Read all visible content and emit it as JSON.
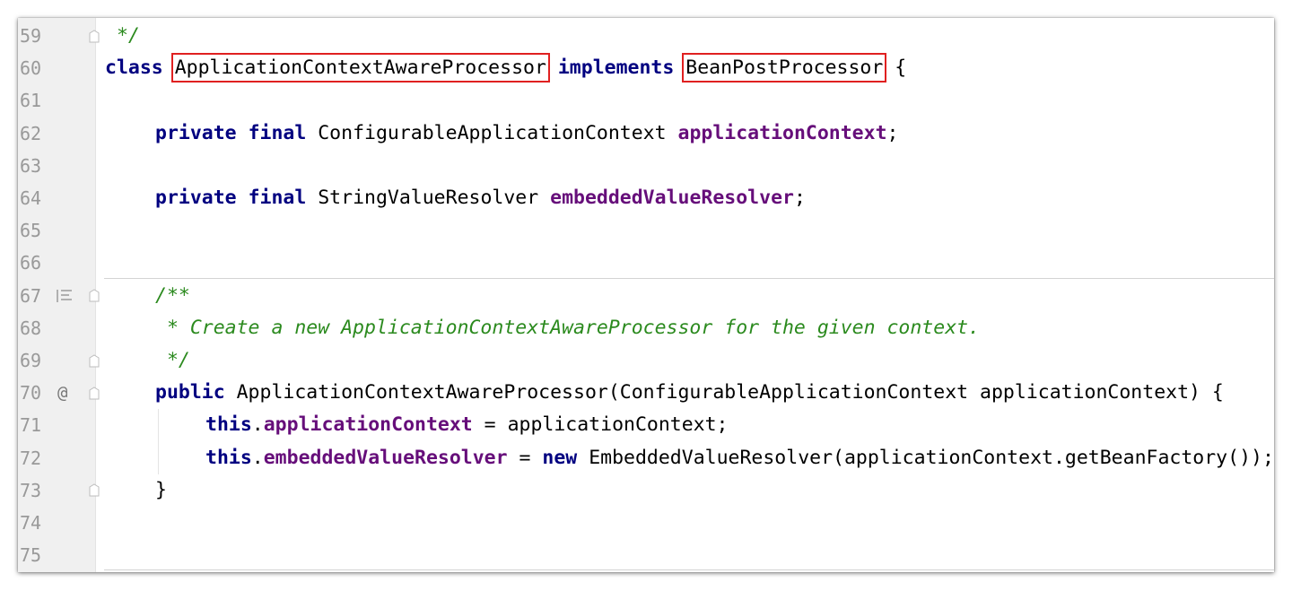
{
  "editor": {
    "lines": [
      {
        "num": "59",
        "tokens": [
          {
            "t": " */",
            "c": "cmt"
          }
        ],
        "indent": 0,
        "fold": true
      },
      {
        "num": "60",
        "tokens": [
          {
            "t": "class",
            "c": "kw"
          },
          {
            "t": " "
          },
          {
            "t": "ApplicationContextAwareProcessor",
            "hl": true
          },
          {
            "t": " "
          },
          {
            "t": "implements",
            "c": "kw"
          },
          {
            "t": " "
          },
          {
            "t": "BeanPostProcessor",
            "hl": true
          },
          {
            "t": " {"
          }
        ],
        "indent": 0
      },
      {
        "num": "61",
        "tokens": [],
        "indent": 0
      },
      {
        "num": "62",
        "tokens": [
          {
            "t": "private",
            "c": "kw"
          },
          {
            "t": " "
          },
          {
            "t": "final",
            "c": "kw"
          },
          {
            "t": " ConfigurableApplicationContext "
          },
          {
            "t": "applicationContext",
            "c": "fld"
          },
          {
            "t": ";"
          }
        ],
        "indent": 1
      },
      {
        "num": "63",
        "tokens": [],
        "indent": 0
      },
      {
        "num": "64",
        "tokens": [
          {
            "t": "private",
            "c": "kw"
          },
          {
            "t": " "
          },
          {
            "t": "final",
            "c": "kw"
          },
          {
            "t": " StringValueResolver "
          },
          {
            "t": "embeddedValueResolver",
            "c": "fld"
          },
          {
            "t": ";"
          }
        ],
        "indent": 1
      },
      {
        "num": "65",
        "tokens": [],
        "indent": 0
      },
      {
        "num": "66",
        "tokens": [],
        "indent": 0,
        "separator_after": true
      },
      {
        "num": "67",
        "tokens": [
          {
            "t": "/**",
            "c": "cmt"
          }
        ],
        "indent": 1,
        "doc_icon": true,
        "fold": true
      },
      {
        "num": "68",
        "tokens": [
          {
            "t": " * Create a new ApplicationContextAwareProcessor for the given context.",
            "c": "cmt"
          }
        ],
        "indent": 1
      },
      {
        "num": "69",
        "tokens": [
          {
            "t": " */",
            "c": "cmt"
          }
        ],
        "indent": 1,
        "fold": true
      },
      {
        "num": "70",
        "tokens": [
          {
            "t": "public",
            "c": "kw"
          },
          {
            "t": " ApplicationContextAwareProcessor(ConfigurableApplicationContext applicationContext) {"
          }
        ],
        "indent": 1,
        "annotation": "@",
        "fold": true
      },
      {
        "num": "71",
        "tokens": [
          {
            "t": "this",
            "c": "kw"
          },
          {
            "t": "."
          },
          {
            "t": "applicationContext",
            "c": "fld"
          },
          {
            "t": " = applicationContext;"
          }
        ],
        "indent": 2
      },
      {
        "num": "72",
        "tokens": [
          {
            "t": "this",
            "c": "kw"
          },
          {
            "t": "."
          },
          {
            "t": "embeddedValueResolver",
            "c": "fld"
          },
          {
            "t": " = "
          },
          {
            "t": "new",
            "c": "kw"
          },
          {
            "t": " EmbeddedValueResolver(applicationContext.getBeanFactory());"
          }
        ],
        "indent": 2
      },
      {
        "num": "73",
        "tokens": [
          {
            "t": "}"
          }
        ],
        "indent": 1,
        "fold": true
      },
      {
        "num": "74",
        "tokens": [],
        "indent": 0
      },
      {
        "num": "75",
        "tokens": [],
        "indent": 0,
        "separator_after": true
      }
    ]
  },
  "colors": {
    "keyword": "#000080",
    "field": "#660e7a",
    "comment": "#2b8a1e",
    "highlight_box": "#e02020",
    "gutter_bg": "#f0f0f0",
    "line_number": "#999999"
  }
}
